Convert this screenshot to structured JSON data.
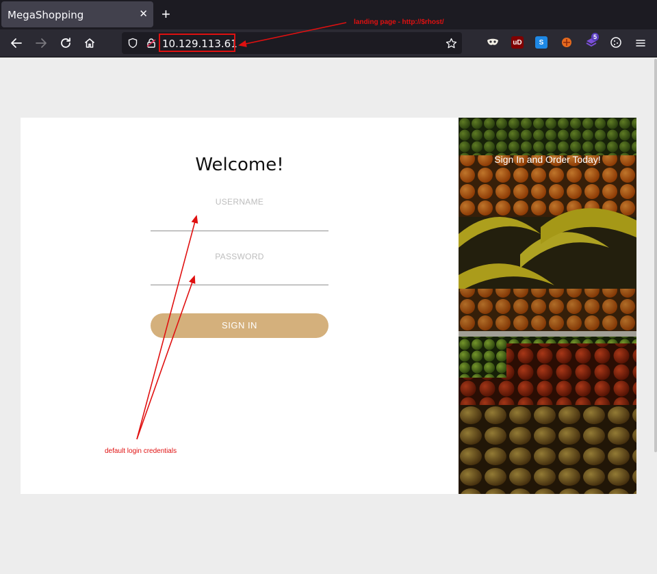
{
  "browser": {
    "tab_title": "MegaShopping",
    "tab_close": "✕",
    "new_tab": "+",
    "url": "10.129.113.61",
    "badge_count": "5"
  },
  "page": {
    "welcome": "Welcome!",
    "username_label": "USERNAME",
    "password_label": "PASSWORD",
    "signin_button": "SIGN IN",
    "side_title": "Sign In and Order Today!"
  },
  "annotations": {
    "top_note": "landing page - http://$rhost/",
    "bottom_note": "default login credentials"
  },
  "colors": {
    "accent": "#d4b07c",
    "annotation": "#e01010"
  }
}
